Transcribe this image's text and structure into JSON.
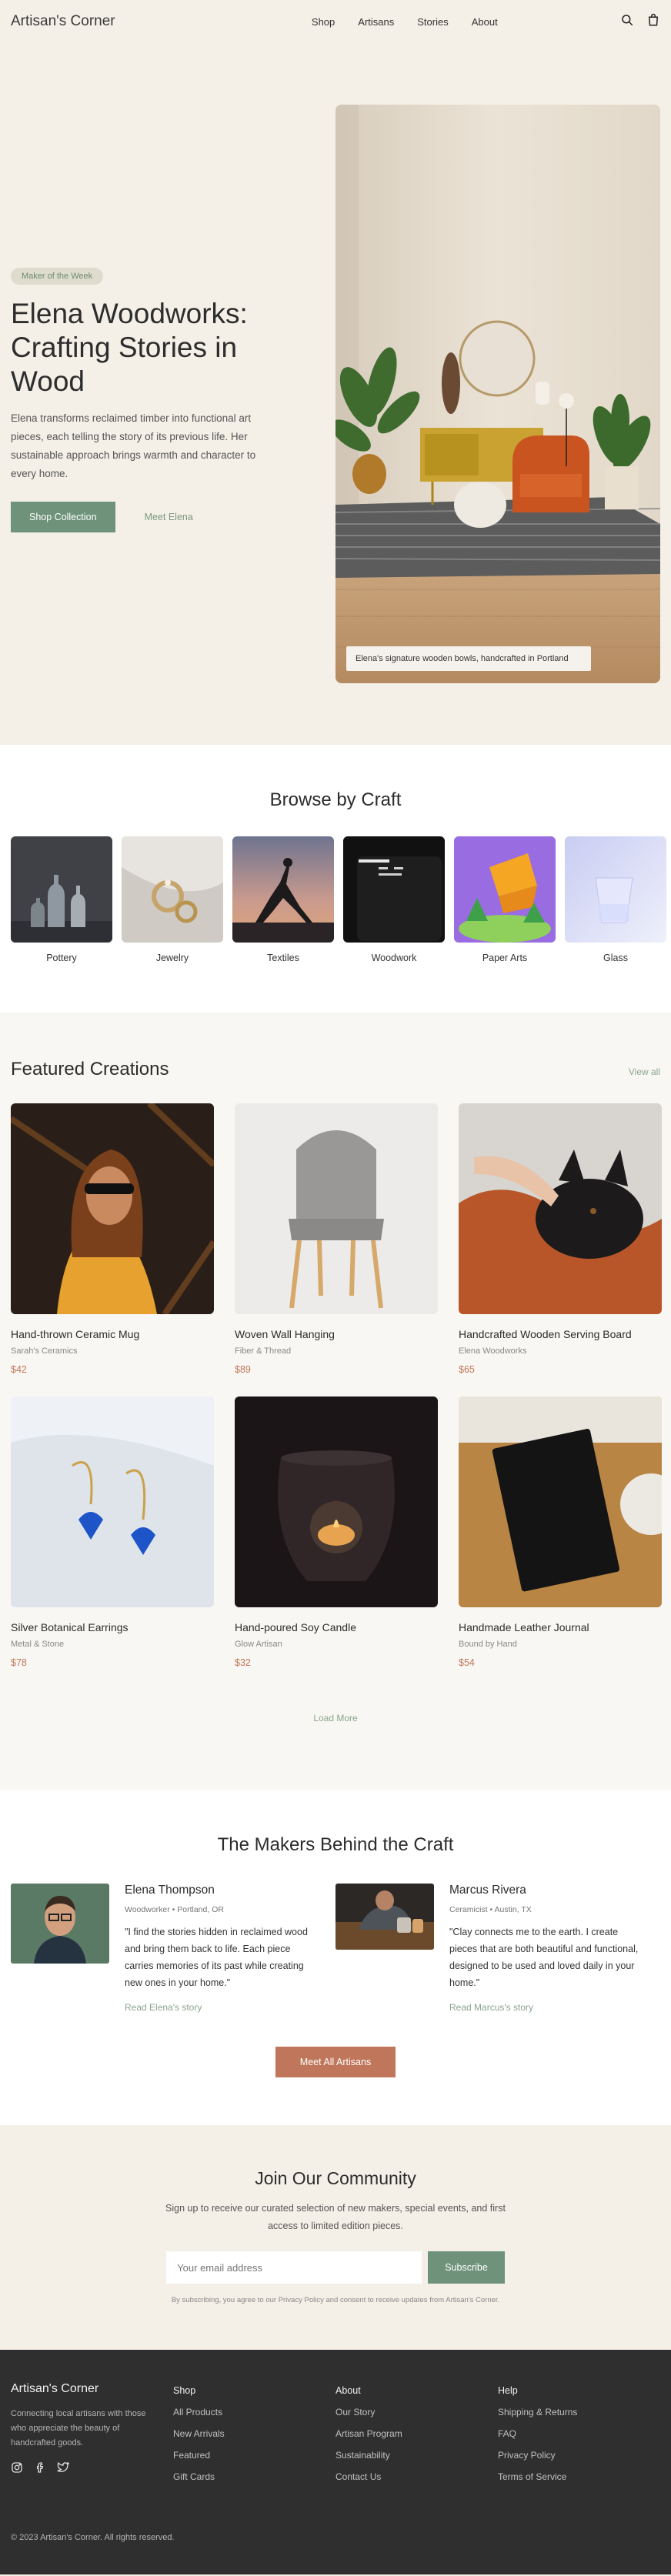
{
  "header": {
    "logo": "Artisan's Corner",
    "nav": [
      "Shop",
      "Artisans",
      "Stories",
      "About"
    ]
  },
  "hero": {
    "badge": "Maker of the Week",
    "title": "Elena Woodworks: Crafting Stories in Wood",
    "description": "Elena transforms reclaimed timber into functional art pieces, each telling the story of its previous life. Her sustainable approach brings warmth and character to every home.",
    "primary_button": "Shop Collection",
    "secondary_button": "Meet Elena",
    "caption": "Elena's signature wooden bowls, handcrafted in Portland"
  },
  "browse": {
    "title": "Browse by Craft",
    "crafts": [
      "Pottery",
      "Jewelry",
      "Textiles",
      "Woodwork",
      "Paper Arts",
      "Glass"
    ]
  },
  "featured": {
    "title": "Featured Creations",
    "view_all": "View all",
    "products": [
      {
        "name": "Hand-thrown Ceramic Mug",
        "maker": "Sarah's Ceramics",
        "price": "$42"
      },
      {
        "name": "Woven Wall Hanging",
        "maker": "Fiber & Thread",
        "price": "$89"
      },
      {
        "name": "Handcrafted Wooden Serving Board",
        "maker": "Elena Woodworks",
        "price": "$65"
      },
      {
        "name": "Silver Botanical Earrings",
        "maker": "Metal & Stone",
        "price": "$78"
      },
      {
        "name": "Hand-poured Soy Candle",
        "maker": "Glow Artisan",
        "price": "$32"
      },
      {
        "name": "Handmade Leather Journal",
        "maker": "Bound by Hand",
        "price": "$54"
      }
    ],
    "load_more": "Load More"
  },
  "makers": {
    "title": "The Makers Behind the Craft",
    "people": [
      {
        "name": "Elena Thompson",
        "role": "Woodworker • Portland, OR",
        "quote": "\"I find the stories hidden in reclaimed wood and bring them back to life. Each piece carries memories of its past while creating new ones in your home.\"",
        "link": "Read Elena's story"
      },
      {
        "name": "Marcus Rivera",
        "role": "Ceramicist • Austin, TX",
        "quote": "\"Clay connects me to the earth. I create pieces that are both beautiful and functional, designed to be used and loved daily in your home.\"",
        "link": "Read Marcus's story"
      }
    ],
    "button": "Meet All Artisans"
  },
  "community": {
    "title": "Join Our Community",
    "description": "Sign up to receive our curated selection of new makers, special events, and first access to limited edition pieces.",
    "placeholder": "Your email address",
    "button": "Subscribe",
    "note": "By subscribing, you agree to our Privacy Policy and consent to receive updates from Artisan's Corner."
  },
  "footer": {
    "brand": "Artisan's Corner",
    "about": "Connecting local artisans with those who appreciate the beauty of handcrafted goods.",
    "shop": {
      "title": "Shop",
      "links": [
        "All Products",
        "New Arrivals",
        "Featured",
        "Gift Cards"
      ]
    },
    "about_col": {
      "title": "About",
      "links": [
        "Our Story",
        "Artisan Program",
        "Sustainability",
        "Contact Us"
      ]
    },
    "help": {
      "title": "Help",
      "links": [
        "Shipping & Returns",
        "FAQ",
        "Privacy Policy",
        "Terms of Service"
      ]
    },
    "copyright": "© 2023 Artisan's Corner. All rights reserved."
  },
  "colors": {
    "accent_green": "#6f937a",
    "accent_orange": "#c0765a",
    "background": "#f4efe7",
    "footer": "#2f2f2f"
  }
}
